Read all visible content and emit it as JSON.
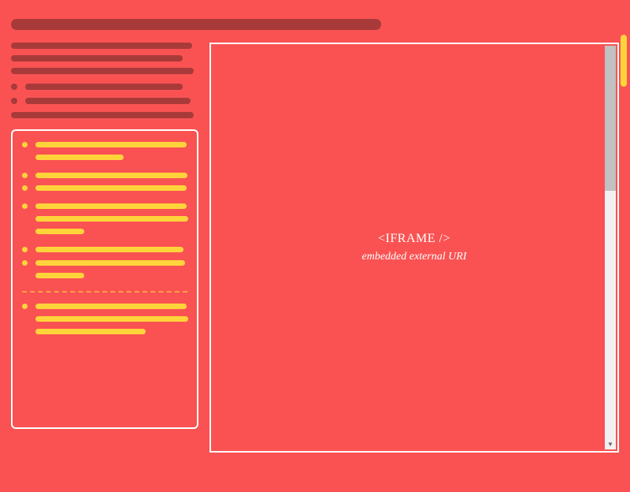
{
  "iframe": {
    "title": "<IFRAME />",
    "subtitle": "embedded external URI"
  }
}
